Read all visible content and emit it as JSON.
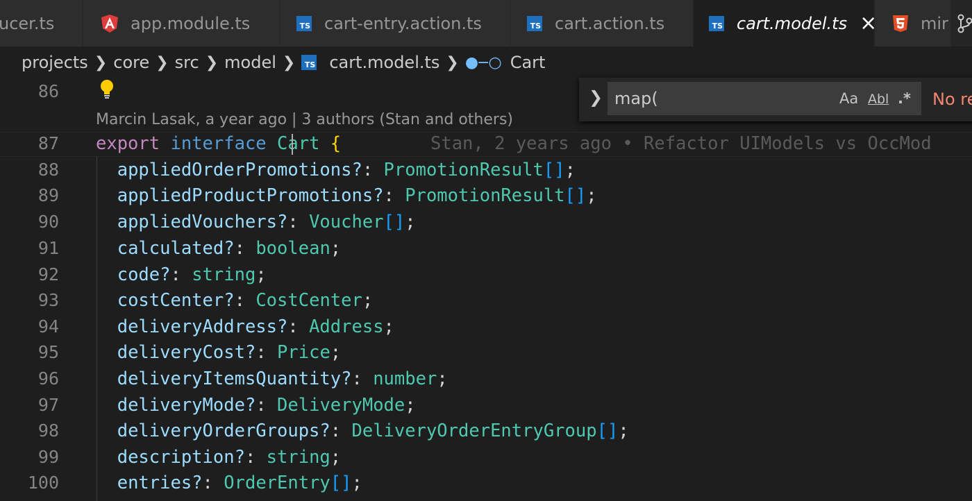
{
  "tabs": [
    {
      "label": "ucer.ts",
      "icon": "none"
    },
    {
      "label": "app.module.ts",
      "icon": "angular-icon"
    },
    {
      "label": "cart-entry.action.ts",
      "icon": "typescript-icon"
    },
    {
      "label": "cart.action.ts",
      "icon": "typescript-icon"
    },
    {
      "label": "cart.model.ts",
      "icon": "typescript-icon",
      "active": true
    },
    {
      "label": "mir",
      "icon": "html5-icon"
    }
  ],
  "breadcrumb": {
    "parts": [
      "projects",
      "core",
      "src",
      "model"
    ],
    "file": "cart.model.ts",
    "symbol": "Cart"
  },
  "find": {
    "query": "map(",
    "match_case": "Aa",
    "whole_word": "Abl",
    "regex": ".*",
    "status": "No re"
  },
  "codelens": "Marcin Lasak, a year ago | 3 authors (Stan and others)",
  "blame": "Stan, 2 years ago • Refactor UIModels vs OccMod",
  "line_numbers": [
    "86",
    "87",
    "88",
    "89",
    "90",
    "91",
    "92",
    "93",
    "94",
    "95",
    "96",
    "97",
    "98",
    "99",
    "100"
  ],
  "code": {
    "l87": {
      "k1": "export",
      "k2": "interface",
      "name": "Cart",
      "brace": "{"
    },
    "props": [
      {
        "name": "appliedOrderPromotions?",
        "type": "PromotionResult",
        "array": "[]"
      },
      {
        "name": "appliedProductPromotions?",
        "type": "PromotionResult",
        "array": "[]"
      },
      {
        "name": "appliedVouchers?",
        "type": "Voucher",
        "array": "[]"
      },
      {
        "name": "calculated?",
        "type": "boolean",
        "array": ""
      },
      {
        "name": "code?",
        "type": "string",
        "array": ""
      },
      {
        "name": "costCenter?",
        "type": "CostCenter",
        "array": ""
      },
      {
        "name": "deliveryAddress?",
        "type": "Address",
        "array": ""
      },
      {
        "name": "deliveryCost?",
        "type": "Price",
        "array": ""
      },
      {
        "name": "deliveryItemsQuantity?",
        "type": "number",
        "array": ""
      },
      {
        "name": "deliveryMode?",
        "type": "DeliveryMode",
        "array": ""
      },
      {
        "name": "deliveryOrderGroups?",
        "type": "DeliveryOrderEntryGroup",
        "array": "[]"
      },
      {
        "name": "description?",
        "type": "string",
        "array": ""
      },
      {
        "name": "entries?",
        "type": "OrderEntry",
        "array": "[]"
      }
    ]
  },
  "colors": {
    "keyword": "#c586c0",
    "keyword2": "#569cd6",
    "type": "#4ec9b0",
    "property": "#9cdcfe",
    "bracket": "#179fff",
    "brace": "#ffd700"
  }
}
